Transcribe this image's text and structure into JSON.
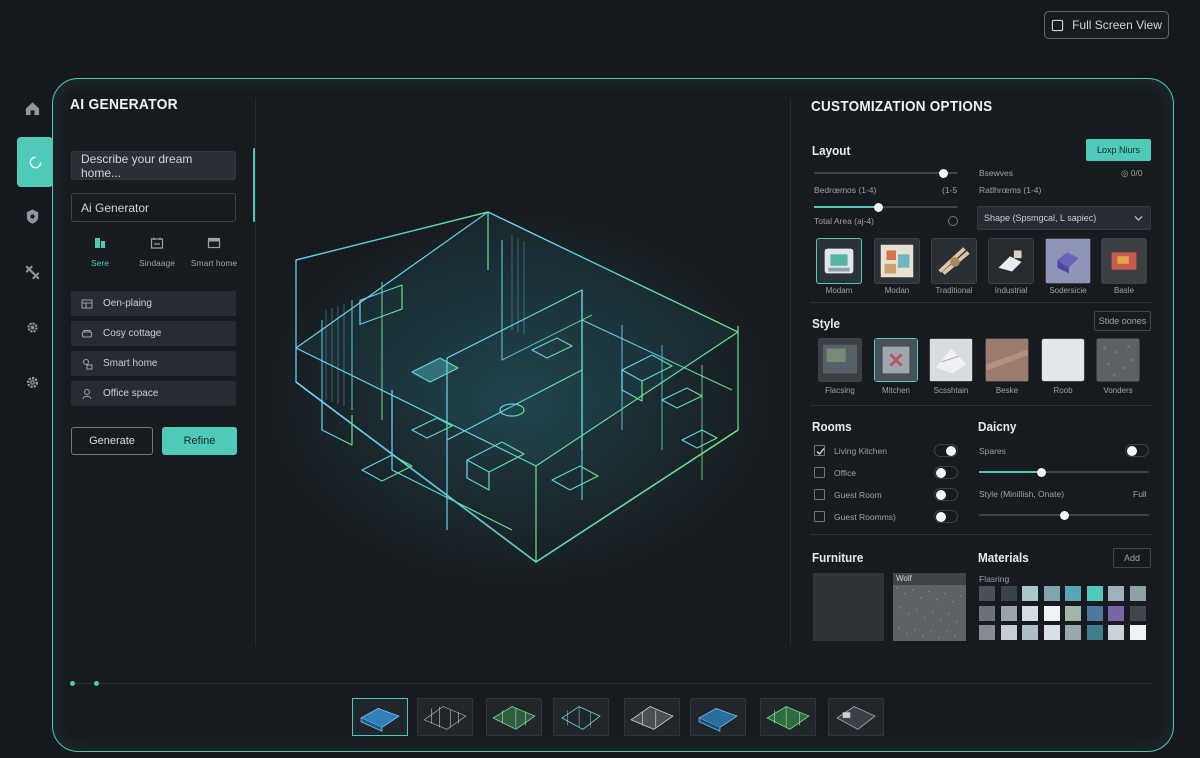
{
  "header": {
    "fullscreen_label": "Full Screen View"
  },
  "left": {
    "title": "AI GENERATOR",
    "prompt_value": "Describe your dream home...",
    "generator_value": "Ai Generator",
    "modes": [
      {
        "label": "Sere"
      },
      {
        "label": "Sindaage"
      },
      {
        "label": "Smart home"
      }
    ],
    "presets": [
      {
        "label": "Oen-plaing"
      },
      {
        "label": "Cosy cottage"
      },
      {
        "label": "Smart home"
      },
      {
        "label": "Office space"
      }
    ],
    "generate_label": "Generate",
    "refine_label": "Refine"
  },
  "right": {
    "title": "CUSTOMIZATION OPTIONS",
    "layout": {
      "title": "Layout",
      "button": "Loxp Niurs",
      "bedrooms_label": "Bedrœmos (1-4)",
      "bedrooms_range": "(1-5",
      "total_area_label": "Total Area (aj-4)",
      "bewves_label": "Bsewves",
      "bewves_value": "◎ 0/0",
      "bathrooms_label": "Ratlhrœms (1-4)",
      "shape_value": "Shape (Spsmgcal, L sapiec)",
      "bedrooms_fraction": 0.45,
      "top_slider_fraction": 0.9,
      "styles": [
        "Modam",
        "Modan",
        "Traditional",
        "Industrial",
        "Sodersicie",
        "Basle"
      ]
    },
    "style": {
      "title": "Style",
      "button": "Stide oones",
      "materials": [
        "Flacsing",
        "Mitchen",
        "Scsshtain",
        "Beske",
        "Roob",
        "Vonders"
      ]
    },
    "rooms": {
      "title": "Rooms",
      "items": [
        {
          "label": "Living Kitchen",
          "checked": true
        },
        {
          "label": "Office",
          "checked": false
        },
        {
          "label": "Guest Room",
          "checked": false
        },
        {
          "label": "Guest Roomms)",
          "checked": false
        }
      ]
    },
    "daicny": {
      "title": "Daicny",
      "spares_label": "Spares",
      "style_label": "Style (Minillish, Onate)",
      "style_value": "Full",
      "spares_fraction": 0.37,
      "style_fraction": 0.5
    },
    "furniture": {
      "title": "Furniture",
      "wolf_label": "Wolf"
    },
    "materials": {
      "title": "Materials",
      "button": "Add",
      "flooring_label": "Flasring",
      "swatches": [
        "#4a5055",
        "#38434a",
        "#a9c6cd",
        "#7fa6ae",
        "#56a6b8",
        "#4fc9b8",
        "#9fb1bd",
        "#8fa1a8",
        "#6b7379",
        "#9aa4aa",
        "#d4dde1",
        "#eef2f4",
        "#9fb6a8",
        "#4e79a0",
        "#7866a8",
        "#3f474d",
        "#848c92",
        "#c4ced3",
        "#aebec6",
        "#d7e0e4",
        "#98a7ae",
        "#3f7f8d",
        "#c7d3d9",
        "#eef3f5"
      ]
    }
  }
}
